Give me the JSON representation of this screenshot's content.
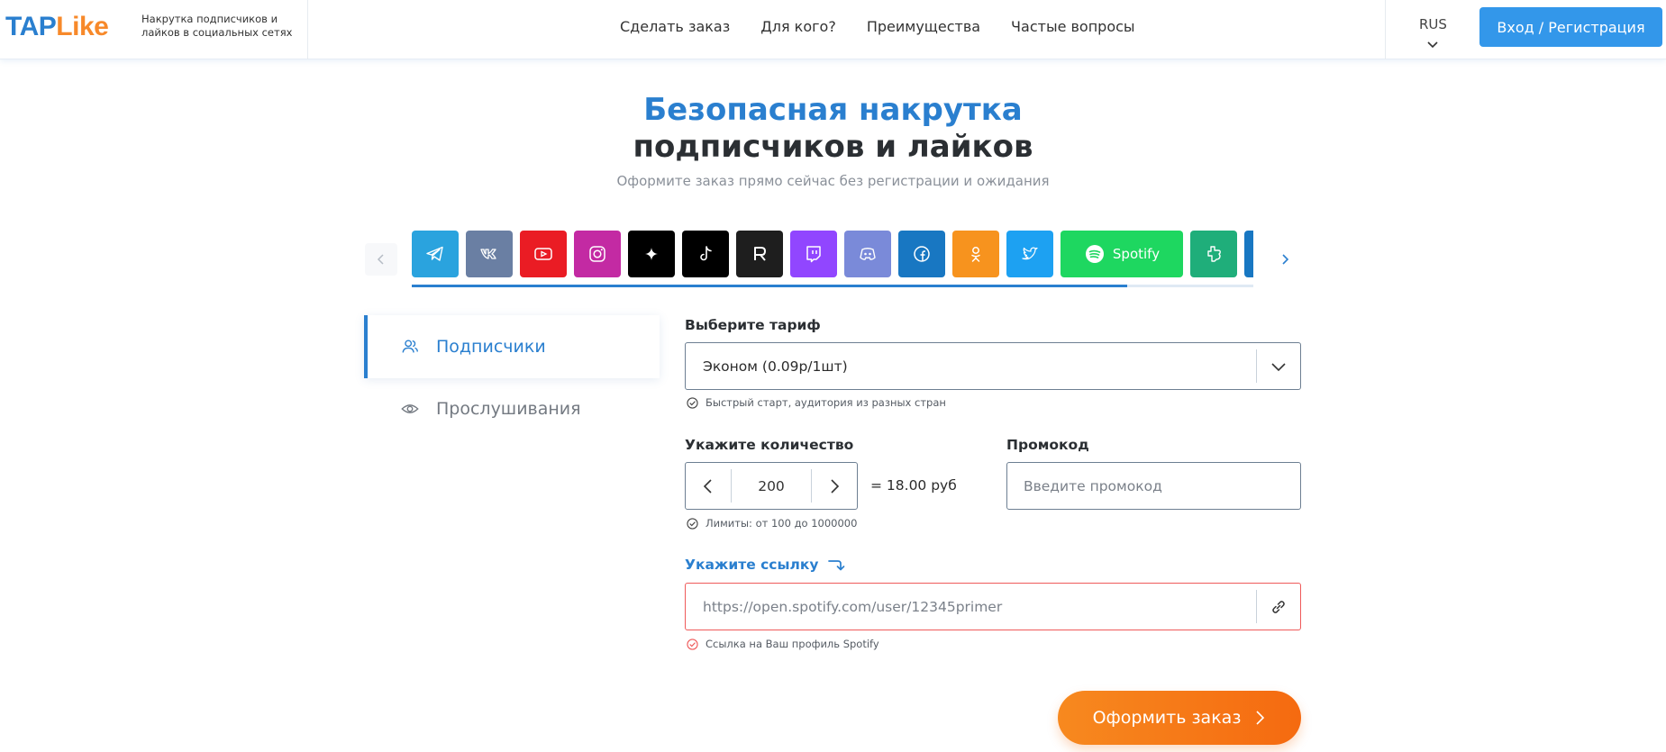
{
  "header": {
    "logo_tap": "TAP",
    "logo_like": "Like",
    "tagline": "Накрутка подписчиков и лайков в социальных сетях",
    "nav": [
      "Сделать заказ",
      "Для кого?",
      "Преимущества",
      "Частые вопросы"
    ],
    "language": "RUS",
    "login_label": "Вход / Регистрация"
  },
  "hero": {
    "title_line1": "Безопасная накрутка",
    "title_line2": "подписчиков и лайков",
    "subtitle": "Оформите заказ прямо сейчас без регистрации и ожидания"
  },
  "platforms": {
    "items": [
      {
        "icon": "telegram-icon",
        "color": "#2aa3de"
      },
      {
        "icon": "vk-icon",
        "color": "#6a7fa3"
      },
      {
        "icon": "youtube-icon",
        "color": "#ea1c24"
      },
      {
        "icon": "instagram-icon",
        "color": "#c32aa3"
      },
      {
        "icon": "sparkle-icon",
        "color": "#000000"
      },
      {
        "icon": "tiktok-icon",
        "color": "#000000"
      },
      {
        "icon": "rutube-icon",
        "color": "#1e1e1e"
      },
      {
        "icon": "twitch-icon",
        "color": "#9146ff"
      },
      {
        "icon": "discord-icon",
        "color": "#7a8ad9"
      },
      {
        "icon": "facebook-icon",
        "color": "#1877c2"
      },
      {
        "icon": "odnoklassniki-icon",
        "color": "#f7931e"
      },
      {
        "icon": "twitter-icon",
        "color": "#1da1f2"
      },
      {
        "icon": "spotify-icon",
        "color": "#1ed760",
        "label": "Spotify",
        "selected": true
      },
      {
        "icon": "likee-icon",
        "color": "#1fae7a"
      },
      {
        "icon": "partial-icon",
        "color": "#1877c2"
      }
    ],
    "scroll_progress": 0.85
  },
  "tabs": [
    {
      "label": "Подписчики",
      "icon": "users-icon",
      "active": true
    },
    {
      "label": "Прослушивания",
      "icon": "eye-icon",
      "active": false
    }
  ],
  "form": {
    "tariff_label": "Выберите тариф",
    "tariff_value": "Эконом (0.09р/1шт)",
    "tariff_hint": "Быстрый старт, аудитория из разных стран",
    "quantity_label": "Укажите количество",
    "quantity_value": "200",
    "price_text": "= 18.00 руб",
    "quantity_hint": "Лимиты: от 100 до 1000000",
    "promo_label": "Промокод",
    "promo_placeholder": "Введите промокод",
    "link_label": "Укажите ссылку",
    "link_placeholder": "https://open.spotify.com/user/12345primer",
    "link_hint": "Ссылка на Ваш профиль Spotify",
    "submit_label": "Оформить заказ"
  },
  "colors": {
    "brand_blue": "#2a7fcf",
    "brand_orange": "#f7892a",
    "error_red": "#ef5a5a"
  }
}
